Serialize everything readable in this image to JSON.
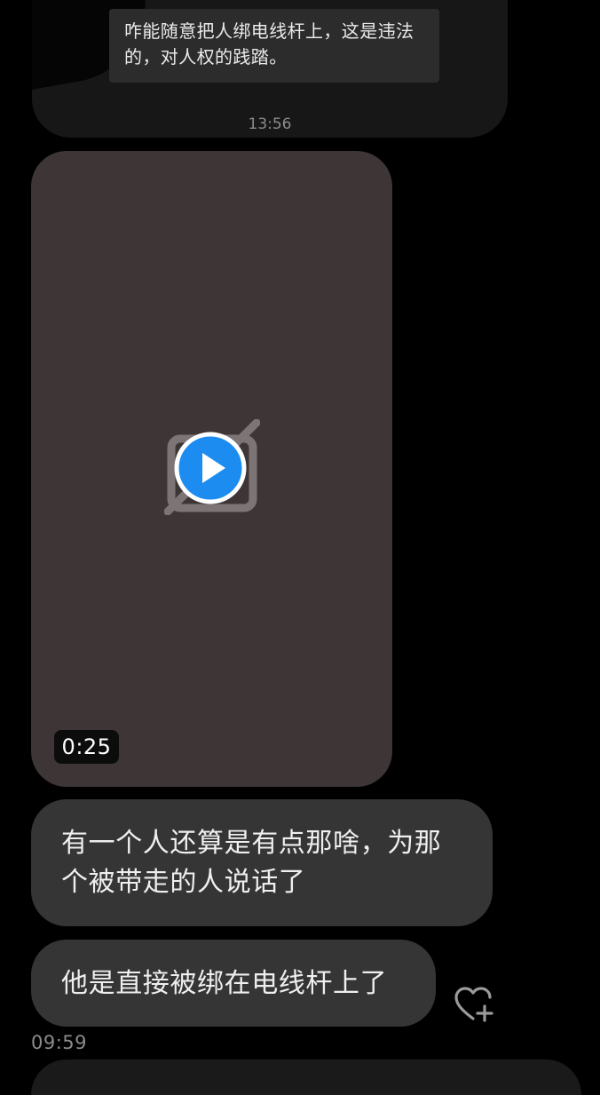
{
  "previous_message": {
    "quote_text": "咋能随意把人绑电线杆上，这是违法的，对人权的践踏。",
    "timestamp": "13:56"
  },
  "video_message": {
    "duration": "0:25",
    "play_icon": "play-icon",
    "placeholder_icon": "broken-image-icon"
  },
  "messages": [
    {
      "text": "有一个人还算是有点那啥，为那个被带走的人说话了"
    },
    {
      "text": "他是直接被绑在电线杆上了"
    }
  ],
  "reaction_icon": "heart-plus-icon",
  "footer": {
    "timestamp": "09:59"
  },
  "colors": {
    "background": "#000000",
    "bubble": "#353535",
    "video_placeholder": "#3e3636",
    "play_button": "#1d8cf0",
    "timestamp": "#8b8b8b"
  }
}
